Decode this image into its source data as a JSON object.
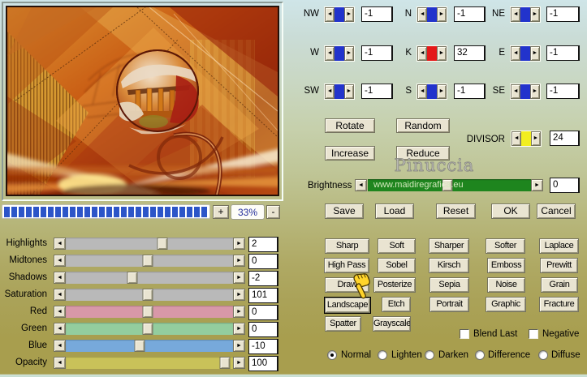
{
  "preview": {
    "zoom_in": "+",
    "zoom_level": "33%",
    "zoom_out": "-"
  },
  "progress": {
    "segments": 28
  },
  "kernel": {
    "cells": [
      {
        "label": "NW",
        "value": "-1"
      },
      {
        "label": "N",
        "value": "-1"
      },
      {
        "label": "NE",
        "value": "-1"
      },
      {
        "label": "W",
        "value": "-1"
      },
      {
        "label": "K",
        "value": "32"
      },
      {
        "label": "E",
        "value": "-1"
      },
      {
        "label": "SW",
        "value": "-1"
      },
      {
        "label": "S",
        "value": "-1"
      },
      {
        "label": "SE",
        "value": "-1"
      }
    ],
    "divisor": {
      "label": "DIVISOR",
      "value": "24"
    }
  },
  "colors": {
    "kernel_marker_blue": "#2233cc",
    "k_marker_red": "#e41818",
    "divisor_marker_yellow": "#f2ee1f",
    "brightness_bar_green": "#1e851e",
    "progress_blue": "#2c55c8",
    "track_red": "#d898a8",
    "track_green": "#93cd9e",
    "track_blue": "#77a9db",
    "track_opacity": "#c9c259"
  },
  "actions": {
    "rotate": "Rotate",
    "random": "Random",
    "increase": "Increase",
    "reduce": "Reduce",
    "save": "Save",
    "load": "Load",
    "reset": "Reset",
    "ok": "OK",
    "cancel": "Cancel"
  },
  "watermark": {
    "name": "Pinuccia",
    "url": "www.maidiregrafica.eu"
  },
  "brightness": {
    "label": "Brightness",
    "value": "0"
  },
  "sliders": [
    {
      "label": "Highlights",
      "value": "2"
    },
    {
      "label": "Midtones",
      "value": "0"
    },
    {
      "label": "Shadows",
      "value": "-2"
    },
    {
      "label": "Saturation",
      "value": "101"
    },
    {
      "label": "Red",
      "value": "0"
    },
    {
      "label": "Green",
      "value": "0"
    },
    {
      "label": "Blue",
      "value": "-10"
    },
    {
      "label": "Opacity",
      "value": "100"
    }
  ],
  "effects": [
    "Sharp",
    "Soft",
    "Sharper",
    "Softer",
    "Laplace",
    "High Pass",
    "Sobel",
    "Kirsch",
    "Emboss",
    "Prewitt",
    "Draw",
    "Posterize",
    "Sepia",
    "Noise",
    "Grain",
    "Landscape",
    "Etch",
    "Portrait",
    "Graphic",
    "Fracture",
    "Spatter",
    "Grayscale"
  ],
  "toggles": {
    "blend_last": "Blend Last",
    "negative": "Negative"
  },
  "modes": [
    {
      "label": "Normal",
      "selected": true
    },
    {
      "label": "Lighten",
      "selected": false
    },
    {
      "label": "Darken",
      "selected": false
    },
    {
      "label": "Difference",
      "selected": false
    },
    {
      "label": "Diffuse",
      "selected": false
    }
  ]
}
